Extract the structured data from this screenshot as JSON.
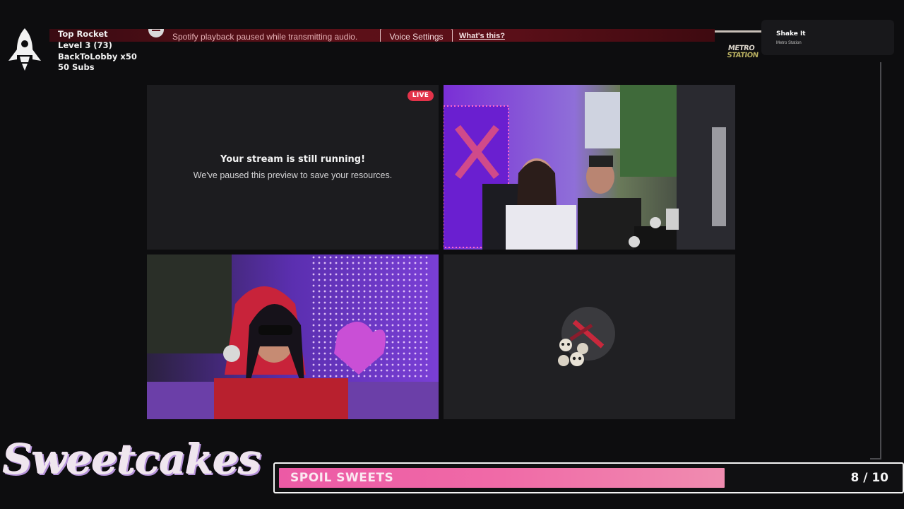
{
  "stats": {
    "line1": "Top Rocket",
    "line2": "Level 3  (73)",
    "line3": "BackToLobby x50",
    "line4": "50 Subs"
  },
  "notice": {
    "text": "Spotify playback paused while transmitting audio.",
    "button_label": "Voice Settings",
    "link_label": "What's this?"
  },
  "now_playing": {
    "album_logo_line1": "METRO",
    "album_logo_line2": "STATION",
    "song_title": "Shake It",
    "artist": "Metro Station"
  },
  "stream_grid": {
    "live_badge": "LIVE",
    "paused_title": "Your stream is still running!",
    "paused_subtitle": "We've paused this preview to save your resources."
  },
  "brand": {
    "name": "Sweetcakes"
  },
  "goal": {
    "label": "SPOIL SWEETS",
    "current": 8,
    "target": 10,
    "count_text": "8 / 10",
    "progress": 0.8
  },
  "colors": {
    "live_badge": "#e3334a",
    "goal_fill": "#ec5aa5",
    "notice_bg": "#5c1018"
  }
}
